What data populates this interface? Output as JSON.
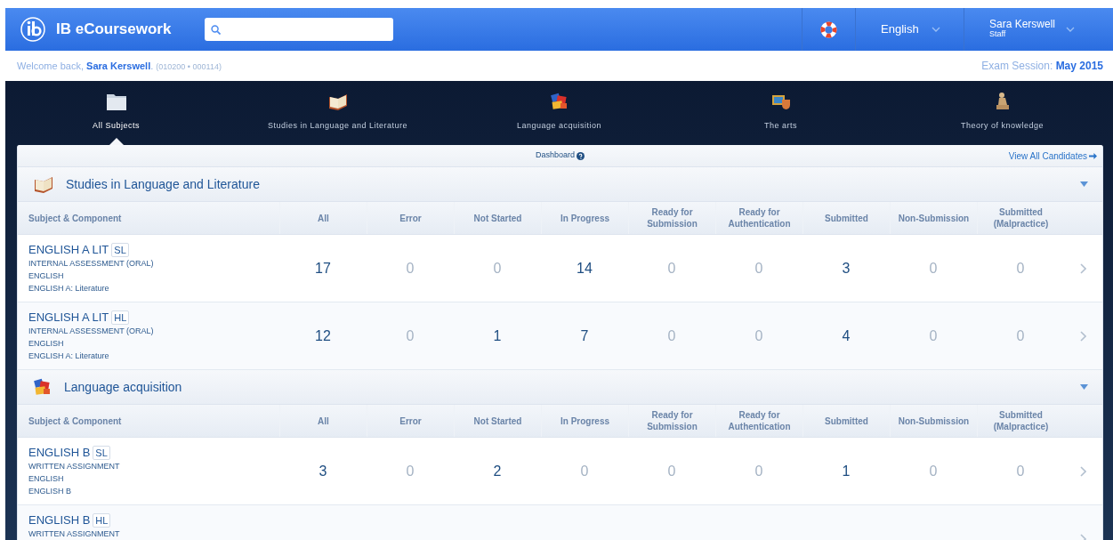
{
  "header": {
    "brand": "IB eCoursework",
    "language": "English",
    "user": {
      "name": "Sara Kerswell",
      "role": "Staff"
    }
  },
  "welcome": {
    "greeting": "Welcome back,",
    "name": "Sara Kerswell",
    "after": ".",
    "ids": "(010200 • 000114)"
  },
  "exam_session": {
    "label": "Exam Session:",
    "value": "May 2015"
  },
  "nav": [
    {
      "label": "All Subjects",
      "selected": true
    },
    {
      "label": "Studies in Language and Literature",
      "selected": false
    },
    {
      "label": "Language acquisition",
      "selected": false
    },
    {
      "label": "The arts",
      "selected": false
    },
    {
      "label": "Theory of knowledge",
      "selected": false
    }
  ],
  "toolbar": {
    "title": "Dashboard",
    "link": "View All Candidates"
  },
  "sections": [
    {
      "title": "Studies in Language and Literature",
      "expanded": true,
      "columns": [
        "Subject & Component",
        "All",
        "Error",
        "Not Started",
        "In Progress",
        "Ready for Submission",
        "Ready for Authentication",
        "Submitted",
        "Non-Submission",
        "Submitted (Malpractice)"
      ],
      "rows": [
        {
          "title": "ENGLISH A LIT",
          "level": "SL",
          "lines": [
            "INTERNAL ASSESSMENT (ORAL)",
            "ENGLISH",
            "ENGLISH A: Literature"
          ],
          "counts": [
            {
              "value": "17",
              "muted": false
            },
            {
              "value": "0",
              "muted": true
            },
            {
              "value": "0",
              "muted": true
            },
            {
              "value": "14",
              "muted": false
            },
            {
              "value": "0",
              "muted": true
            },
            {
              "value": "0",
              "muted": true
            },
            {
              "value": "3",
              "muted": false
            },
            {
              "value": "0",
              "muted": true
            },
            {
              "value": "0",
              "muted": true
            }
          ]
        },
        {
          "title": "ENGLISH A LIT",
          "level": "HL",
          "lines": [
            "INTERNAL ASSESSMENT (ORAL)",
            "ENGLISH",
            "ENGLISH A: Literature"
          ],
          "counts": [
            {
              "value": "12",
              "muted": false
            },
            {
              "value": "0",
              "muted": true
            },
            {
              "value": "1",
              "muted": false
            },
            {
              "value": "7",
              "muted": false
            },
            {
              "value": "0",
              "muted": true
            },
            {
              "value": "0",
              "muted": true
            },
            {
              "value": "4",
              "muted": false
            },
            {
              "value": "0",
              "muted": true
            },
            {
              "value": "0",
              "muted": true
            }
          ]
        }
      ]
    },
    {
      "title": "Language acquisition",
      "expanded": true,
      "columns": [
        "Subject & Component",
        "All",
        "Error",
        "Not Started",
        "In Progress",
        "Ready for Submission",
        "Ready for Authentication",
        "Submitted",
        "Non-Submission",
        "Submitted (Malpractice)"
      ],
      "rows": [
        {
          "title": "ENGLISH B",
          "level": "SL",
          "lines": [
            "WRITTEN ASSIGNMENT",
            "ENGLISH",
            "ENGLISH B"
          ],
          "counts": [
            {
              "value": "3",
              "muted": false
            },
            {
              "value": "0",
              "muted": true
            },
            {
              "value": "2",
              "muted": false
            },
            {
              "value": "0",
              "muted": true
            },
            {
              "value": "0",
              "muted": true
            },
            {
              "value": "0",
              "muted": true
            },
            {
              "value": "1",
              "muted": false
            },
            {
              "value": "0",
              "muted": true
            },
            {
              "value": "0",
              "muted": true
            }
          ]
        },
        {
          "title": "ENGLISH B",
          "level": "HL",
          "lines": [
            "WRITTEN ASSIGNMENT"
          ]
        }
      ]
    }
  ]
}
